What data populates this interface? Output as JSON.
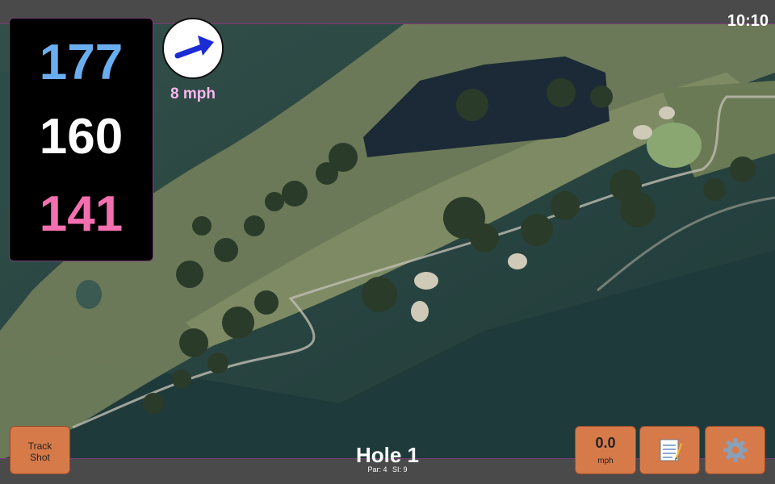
{
  "status": {
    "time": "10:10"
  },
  "distances": {
    "back": "177",
    "middle": "160",
    "front": "141"
  },
  "wind": {
    "speed": "8 mph",
    "icon": "wind-direction-arrow-icon"
  },
  "hole": {
    "title": "Hole 1",
    "par": "Par: 4",
    "si": "SI: 9"
  },
  "buttons": {
    "track_shot": [
      "Track",
      "Shot"
    ],
    "speed_value": "0.0",
    "speed_unit": "mph",
    "notes_icon": "notepad-icon",
    "settings_icon": "gear-icon"
  },
  "colors": {
    "back": "#6aaef0",
    "middle": "#ffffff",
    "front": "#f36fb0",
    "button": "#d67a4a",
    "wind_label": "#f6b8ef"
  }
}
